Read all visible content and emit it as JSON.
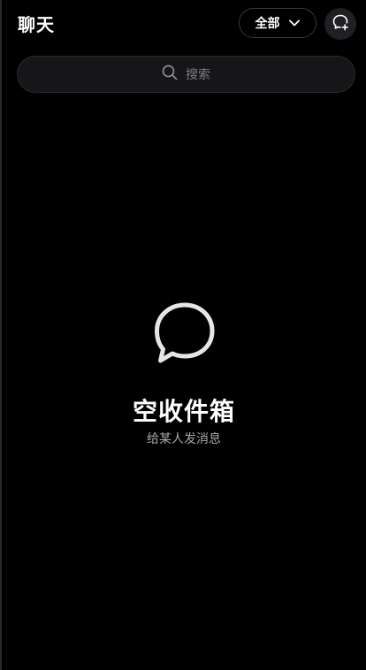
{
  "header": {
    "title": "聊天",
    "filter_label": "全部",
    "filter_icon": "chevron-down-icon",
    "compose_icon": "new-chat-icon"
  },
  "search": {
    "placeholder": "搜索",
    "icon": "search-icon"
  },
  "empty_state": {
    "icon": "chat-bubble-icon",
    "title": "空收件箱",
    "subtitle": "给某人发消息"
  },
  "colors": {
    "background": "#000000",
    "search_background": "#161619",
    "button_background": "#202024",
    "border": "#3a3a3e",
    "text_primary": "#ffffff",
    "text_secondary": "#a8a8ad",
    "placeholder": "#7d7d82"
  }
}
